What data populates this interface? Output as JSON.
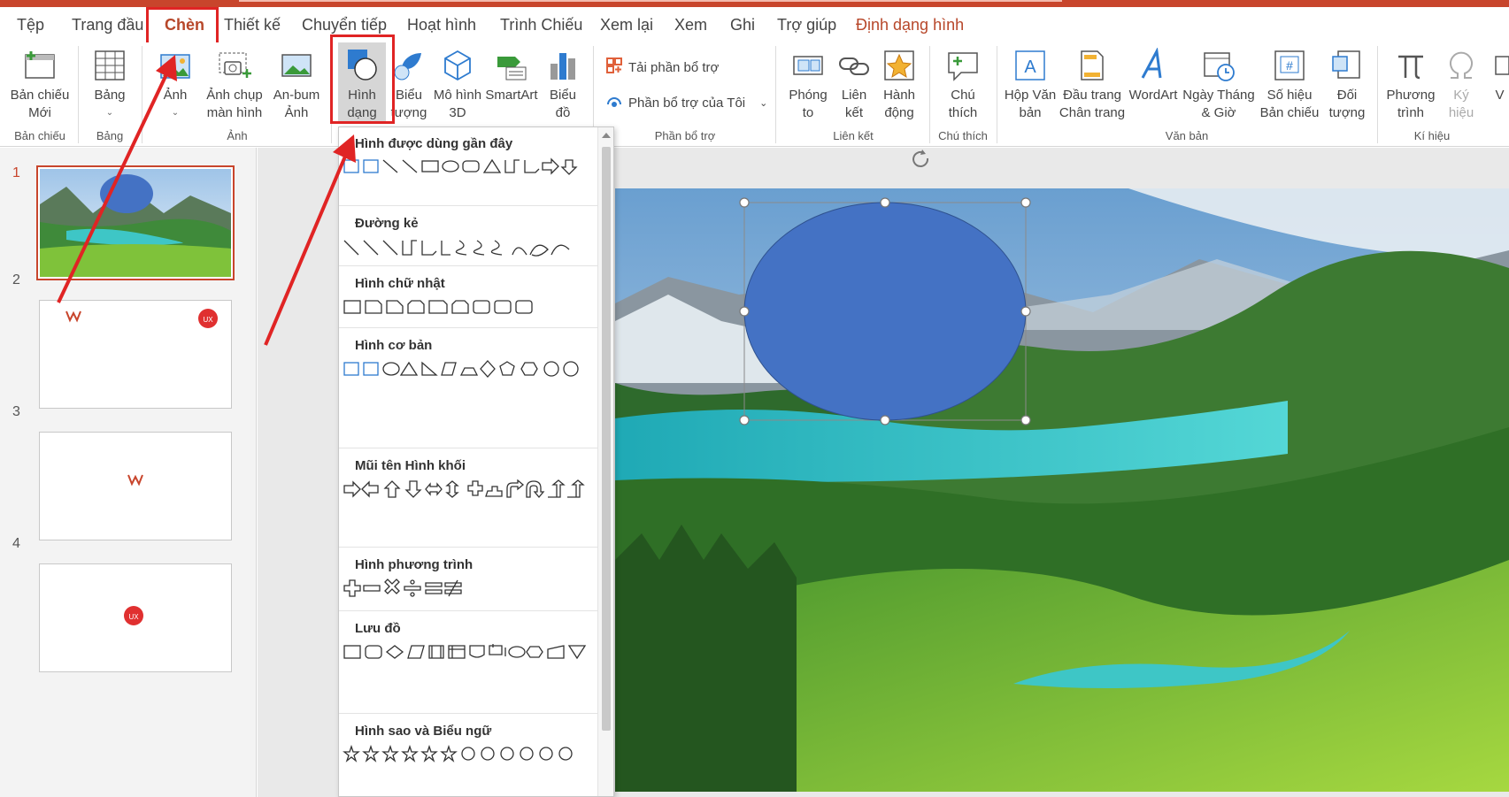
{
  "tabs": [
    {
      "label": "Tệp"
    },
    {
      "label": "Trang đầu"
    },
    {
      "label": "Chèn"
    },
    {
      "label": "Thiết kế"
    },
    {
      "label": "Chuyển tiếp"
    },
    {
      "label": "Hoạt hình"
    },
    {
      "label": "Trình Chiếu"
    },
    {
      "label": "Xem lại"
    },
    {
      "label": "Xem"
    },
    {
      "label": "Ghi"
    },
    {
      "label": "Trợ giúp"
    },
    {
      "label": "Định dạng hình"
    }
  ],
  "ribbon": {
    "new_slide": "Bản chiếu\nMới",
    "table": "Bảng",
    "picture": "Ảnh",
    "screenshot": "Ảnh chụp\nmàn hình",
    "album": "An-bum\nẢnh",
    "shapes": "Hình\ndạng",
    "icons": "Biểu\ntượng",
    "models3d": "Mô hình\n3D",
    "smartart": "SmartArt",
    "chart": "Biểu\nđồ",
    "get_addins": "Tải phần bổ trợ",
    "my_addins": "Phần bổ trợ của Tôi",
    "zoom": "Phóng\nto",
    "link": "Liên\nkết",
    "action": "Hành\nđộng",
    "comment": "Chú\nthích",
    "textbox": "Hộp Văn\nbản",
    "header_footer": "Đầu trang\nChân trang",
    "wordart": "WordArt",
    "datetime": "Ngày Tháng\n& Giờ",
    "slide_number": "Số hiệu\nBản chiếu",
    "object": "Đối\ntượng",
    "equation": "Phương\ntrình",
    "symbol": "Ký\nhiệu",
    "video": "V",
    "groups": {
      "slides": "Bản chiếu",
      "tables": "Bảng",
      "images": "Ảnh",
      "addins": "Phần bổ trợ",
      "links": "Liên kết",
      "comments": "Chú thích",
      "text": "Văn bản",
      "symbols": "Kí hiệu"
    }
  },
  "slides": [
    {
      "num": "1"
    },
    {
      "num": "2"
    },
    {
      "num": "3"
    },
    {
      "num": "4"
    }
  ],
  "shapes_menu": {
    "sections": [
      {
        "title": "Hình được dùng gần đây"
      },
      {
        "title": "Đường kẻ"
      },
      {
        "title": "Hình chữ nhật"
      },
      {
        "title": "Hình cơ bản"
      },
      {
        "title": "Mũi tên Hình khối"
      },
      {
        "title": "Hình phương trình"
      },
      {
        "title": "Lưu đồ"
      },
      {
        "title": "Hình sao và Biểu ngữ"
      }
    ]
  },
  "colors": {
    "accent": "#b7472a",
    "highlight": "#e02424",
    "ellipse": "#4472c4",
    "icon_blue": "#2e7bcf"
  }
}
